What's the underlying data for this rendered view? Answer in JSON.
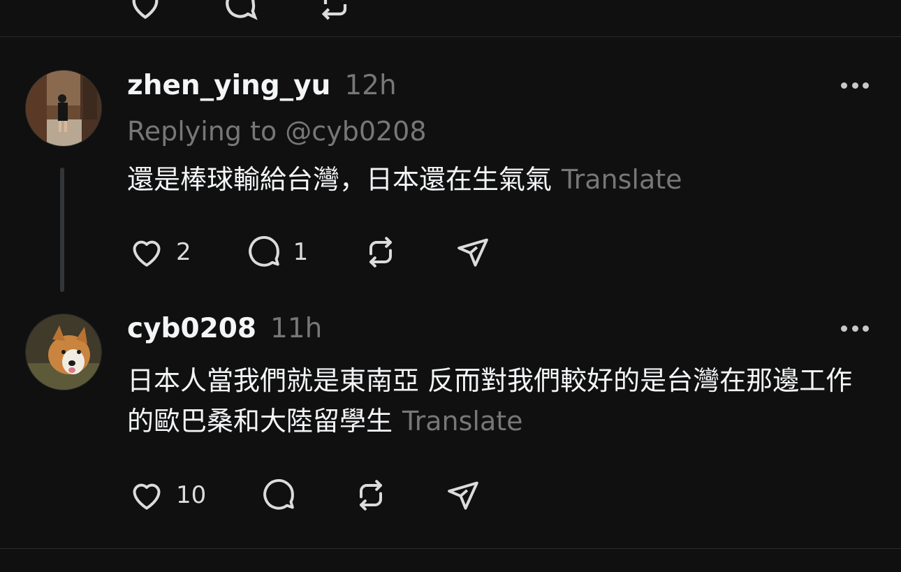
{
  "top_actions": {
    "icons": [
      "heart-icon",
      "comment-icon",
      "repost-icon",
      "share-icon"
    ]
  },
  "posts": [
    {
      "username": "zhen_ying_yu",
      "time": "12h",
      "replying_to": "Replying to @cyb0208",
      "text": "還是棒球輸給台灣，日本還在生氣氣",
      "translate": "Translate",
      "likes": "2",
      "replies": "1",
      "avatar": "avatar-photo-person-alley"
    },
    {
      "username": "cyb0208",
      "time": "11h",
      "text": "日本人當我們就是東南亞 反而對我們較好的是台灣在那邊工作的歐巴桑和大陸留學生",
      "translate": "Translate",
      "likes": "10",
      "avatar": "avatar-photo-corgi-dog"
    }
  ],
  "colors": {
    "background": "#101010",
    "primary_text": "#f3f5f7",
    "secondary_text": "#777777",
    "divider": "#2a2a2a"
  }
}
